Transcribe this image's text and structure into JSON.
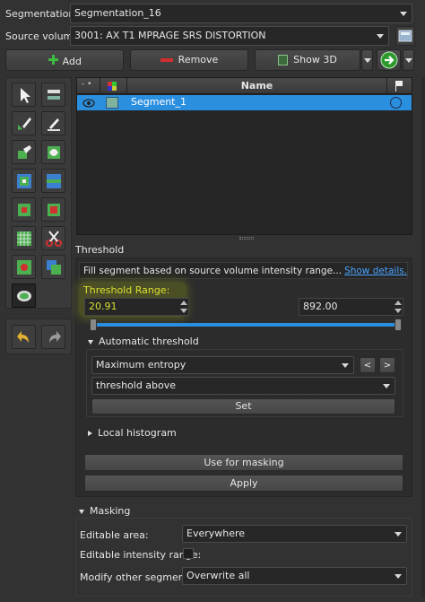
{
  "segmentation": {
    "label": "Segmentation:",
    "value": "Segmentation_16"
  },
  "source_volume": {
    "label": "Source volume:",
    "value": "3001: AX T1 MPRAGE SRS DISTORTION"
  },
  "toolbar": {
    "add_label": "Add",
    "remove_label": "Remove",
    "show3d_label": "Show 3D"
  },
  "table": {
    "col_name": "Name",
    "rows": [
      {
        "name": "Segment_1",
        "color": "#7fb3a0"
      }
    ]
  },
  "effect": {
    "title": "Threshold",
    "description": "Fill segment based on source volume intensity range...",
    "show_details": "Show details.",
    "range_label": "Threshold Range:",
    "min_value": "20.91",
    "max_value": "892.00",
    "range_min_fraction": 0.0,
    "range_max_fraction": 1.0,
    "automatic_threshold_label": "Automatic threshold",
    "method": "Maximum entropy",
    "mode": "threshold above",
    "set_label": "Set",
    "local_histogram_label": "Local histogram",
    "use_for_masking_label": "Use for masking",
    "apply_label": "Apply"
  },
  "masking": {
    "title": "Masking",
    "editable_area_label": "Editable area:",
    "editable_area_value": "Everywhere",
    "editable_intensity_label": "Editable intensity range:",
    "editable_intensity_checked": false,
    "modify_other_label": "Modify other segments:",
    "modify_other_value": "Overwrite all"
  },
  "colors": {
    "accent": "#2b8fe0",
    "highlight": "#c8d21a",
    "link": "#4aa3ff",
    "add_green": "#3fbf3f",
    "remove_red": "#d23030"
  }
}
